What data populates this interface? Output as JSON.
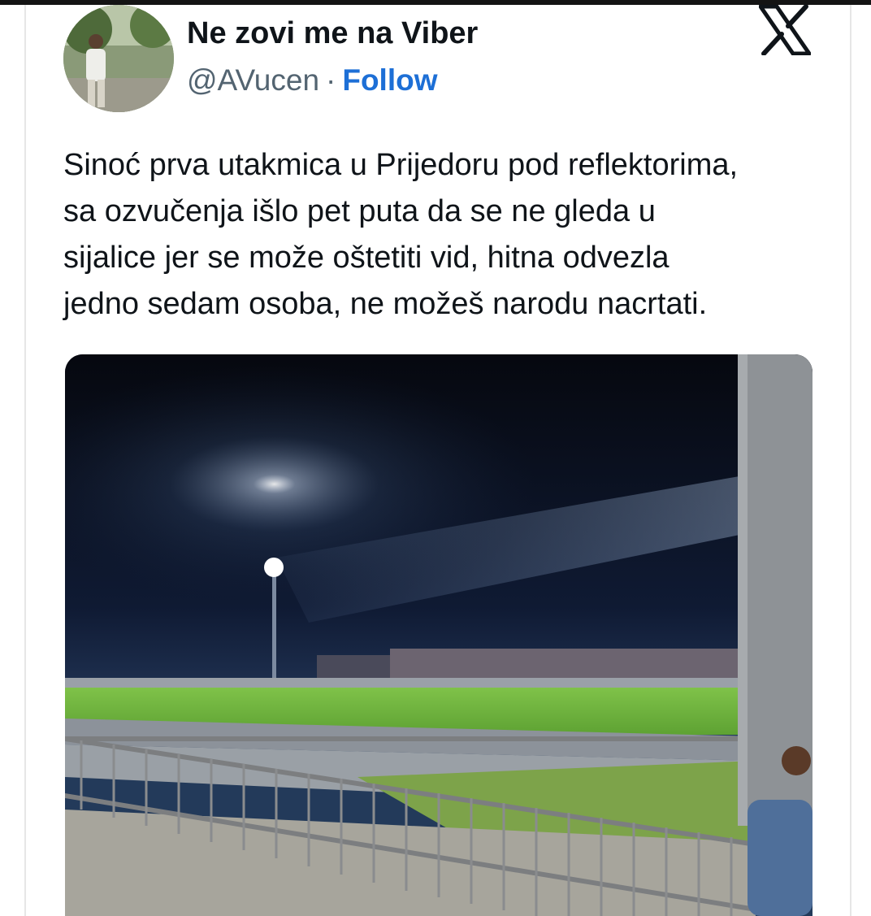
{
  "tweet": {
    "author_name": "Ne zovi me na Viber",
    "handle": "@AVucen",
    "separator": "·",
    "follow_label": "Follow",
    "platform_icon": "x-logo-icon",
    "text_lines": [
      "Sinoć prva utakmica u Prijedoru pod reflektorima,",
      "sa ozvučenja išlo pet puta da se ne gleda u",
      "sijalice jer se može oštetiti vid, hitna odvezla",
      "jedno sedam osoba, ne možeš narodu nacrtati."
    ]
  },
  "media": {
    "type": "photo",
    "subject_icon": "stadium-night-photo"
  },
  "colors": {
    "follow": "#1d6fd6",
    "text": "#0f1419",
    "secondary": "#536471"
  }
}
